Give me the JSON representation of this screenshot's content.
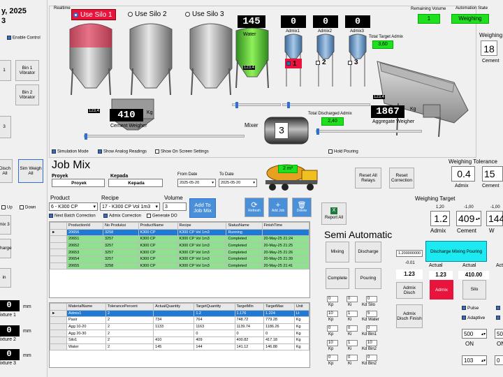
{
  "left": {
    "date": "y, 2025",
    "num": "3",
    "enable_control": "Enable Control",
    "bin1": "Bin 1 Vibrator",
    "bin2": "Bin 2 Vibrator",
    "one": "1",
    "three": "3",
    "disch": "Disch All",
    "simweigh": "Sim Weigh All",
    "up": "Up",
    "down": "Down",
    "mix3": "mix 3",
    "charge": "Charge",
    "in": "in",
    "mm": "mm",
    "fix1": "ixture 1",
    "fix2": "ixture 2",
    "fix3": "ixture 3",
    "zero": "0"
  },
  "realtime": {
    "label": "Realtime",
    "silo1": "Use Silo 1",
    "silo2": "Use Silo 2",
    "silo3": "Use Silo 3",
    "cement_weight": "410",
    "kg": "Kg",
    "cement_weigher": "Cement Weigher",
    "water": "145",
    "water_label": "Water",
    "admix1": "0",
    "admix2": "0",
    "admix3": "0",
    "admix1_lbl": "Admix1",
    "admix2_lbl": "Admix2",
    "admix3_lbl": "Admix3",
    "val1234": "123,4",
    "total_target_admix": "Total Target Admix",
    "target_admix_val": "3,60",
    "agg_weight": "1867",
    "aggregate_weigher": "Aggregate Weigher",
    "total_discharged": "Total Discharged Admix",
    "discharged_val": "2,40",
    "mixer": "Mixer",
    "mixer_val": "3",
    "s1": "1",
    "s2": "2",
    "s3": "3"
  },
  "state": {
    "remaining_label": "Remaining Volume",
    "remaining_val": "1",
    "automation_label": "Automation State",
    "automation_val": "Weighing",
    "weighing": "Weighing",
    "weighing_val": "18",
    "cement": "Cement"
  },
  "options": {
    "sim": "Simulation Mode",
    "analog": "Show Analog Readings",
    "onscreen": "Show On Screen Settings",
    "hold": "Hold Pouring"
  },
  "jobmix": {
    "title": "Job Mix",
    "proyek_lbl": "Proyek",
    "proyek_val": "Proyek",
    "kepada_lbl": "Kepada",
    "kepada_val": "Kepada",
    "from_lbl": "From Date",
    "from_val": "2025-05-20",
    "to_lbl": "To Date",
    "to_val": "2025-05-20",
    "truck_label": "2 m³",
    "reset_relays": "Reset All Relays",
    "reset_correction": "Reset Correction",
    "product_lbl": "Product",
    "product_val": "6 - K300 CP",
    "recipe_lbl": "Recipe",
    "recipe_val": "17 - K300 CP Vol 1m3",
    "volume_lbl": "Volume",
    "volume_val": "3",
    "add_to": "Add To Job Mix",
    "refresh": "Refresh",
    "add_job": "Add Job",
    "delete": "Delete",
    "next_batch": "Next Batch Correction",
    "admix_corr": "Admix Correction",
    "generate_do": "Generate DO"
  },
  "jobtable": {
    "headers": [
      "",
      "ProductionId",
      "No Produksi",
      "ProductName",
      "Recipe",
      "StatusName",
      "FinishTime"
    ],
    "rows": [
      [
        "►",
        "20656",
        "3258",
        "K300 CP",
        "K300 CP Vol 1m3",
        "Running",
        ""
      ],
      [
        "",
        "20651",
        "3257",
        "K300 CP",
        "K300 CP Vol 1m3",
        "Completed",
        "20-May-25 21:24"
      ],
      [
        "",
        "20652",
        "3257",
        "K300 CP",
        "K300 CP Vol 1m3",
        "Completed",
        "20-May-25 21:25"
      ],
      [
        "",
        "20653",
        "3257",
        "K300 CP",
        "K300 CP Vol 1m3",
        "Completed",
        "20-May-25 21:26"
      ],
      [
        "",
        "20654",
        "3257",
        "K300 CP",
        "K300 CP Vol 1m3",
        "Completed",
        "20-May-25 21:39"
      ],
      [
        "",
        "20655",
        "3258",
        "K300 CP",
        "K300 CP Vol 1m3",
        "Completed",
        "20-May-25 21:41"
      ]
    ]
  },
  "mattable": {
    "headers": [
      "",
      "MaterialName",
      "TolerancePercent",
      "ActualQuantity",
      "TargetQuantity",
      "TargetMin",
      "TargetMax",
      "Unit"
    ],
    "rows": [
      [
        "►",
        "Admix1",
        "2",
        "",
        "1.2",
        "1.176",
        "1.224",
        "Lt"
      ],
      [
        "",
        "Pasir",
        "2",
        "734",
        "764",
        "748.72",
        "779.28",
        "Kg"
      ],
      [
        "",
        "Agg 10-20",
        "2",
        "1133",
        "1163",
        "1139.74",
        "1186.26",
        "Kg"
      ],
      [
        "",
        "Agg 20-30",
        "2",
        "",
        "0",
        "0",
        "0",
        "Kg"
      ],
      [
        "",
        "Silo1",
        "2",
        "410",
        "409",
        "400.82",
        "417.18",
        "Kg"
      ],
      [
        "",
        "Water",
        "2",
        "145",
        "144",
        "141.12",
        "146.88",
        "Kg"
      ]
    ]
  },
  "tolerance": {
    "title": "Weighing Tolerance",
    "admix": "0.4",
    "admix_lbl": "Admix",
    "cement": "15",
    "cement_lbl": "Cement"
  },
  "target": {
    "title": "Weighing Target",
    "report": "Report All",
    "a_top": "1,20",
    "a_val": "1.2",
    "a_lbl": "Admix",
    "c_top": "-1,00",
    "c_val": "409",
    "c_lbl": "Cement",
    "w_top": "-1,00",
    "w_val": "144",
    "w_lbl": "W"
  },
  "semi": {
    "title": "Semi Automatic",
    "mixing": "Mixing",
    "discharge": "Discharge",
    "complete": "Complete",
    "pouring": "Pouring",
    "v1": "1.200000000",
    "v2": "-0.01",
    "v3": "1.23",
    "admix_disch": "Admix Disch",
    "admix_disch_finish": "Admix Disch Finish",
    "dmp": "Discharge Mixing Pouring",
    "actual": "Actual",
    "act1": "1.23",
    "act2": "410.00",
    "admix_btn": "Admix",
    "silo_btn": "Silo",
    "pulse": "Pulse",
    "adaptive": "Adaptive",
    "on": "ON",
    "v500": "500",
    "v103": "103",
    "kp": "Kp",
    "ki": "Ki",
    "kd_silo": "Kd Silo",
    "kd_water": "Kd Water",
    "kd_bin1": "Kd Bin1",
    "kd_bin2": "Kd Bin2",
    "kd_bin3": "Kd Bin3",
    "z": "0",
    "ten": "10",
    "one": "1",
    "five": "5",
    "s0": "50"
  },
  "colors": {
    "green": "#1fe01f",
    "cyan": "#1de9f0",
    "red": "#e8143c",
    "blue": "#2d6fd3"
  }
}
